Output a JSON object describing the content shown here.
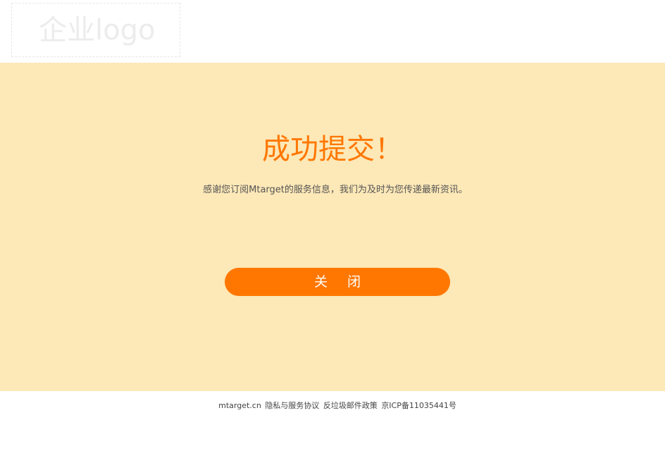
{
  "header": {
    "logo_text": "企业logo"
  },
  "main": {
    "title": "成功提交！",
    "message": "感谢您订阅Mtarget的服务信息，我们为及时为您传递最新资讯。",
    "close_button_label": "关闭"
  },
  "footer": {
    "domain": "mtarget.cn",
    "privacy_link": "隐私与服务协议",
    "antispam_link": "反垃圾邮件政策",
    "icp": "京ICP备11035441号"
  },
  "colors": {
    "accent": "#ff7700",
    "hero_background": "#fde8b7",
    "page_background": "#ffffff"
  }
}
